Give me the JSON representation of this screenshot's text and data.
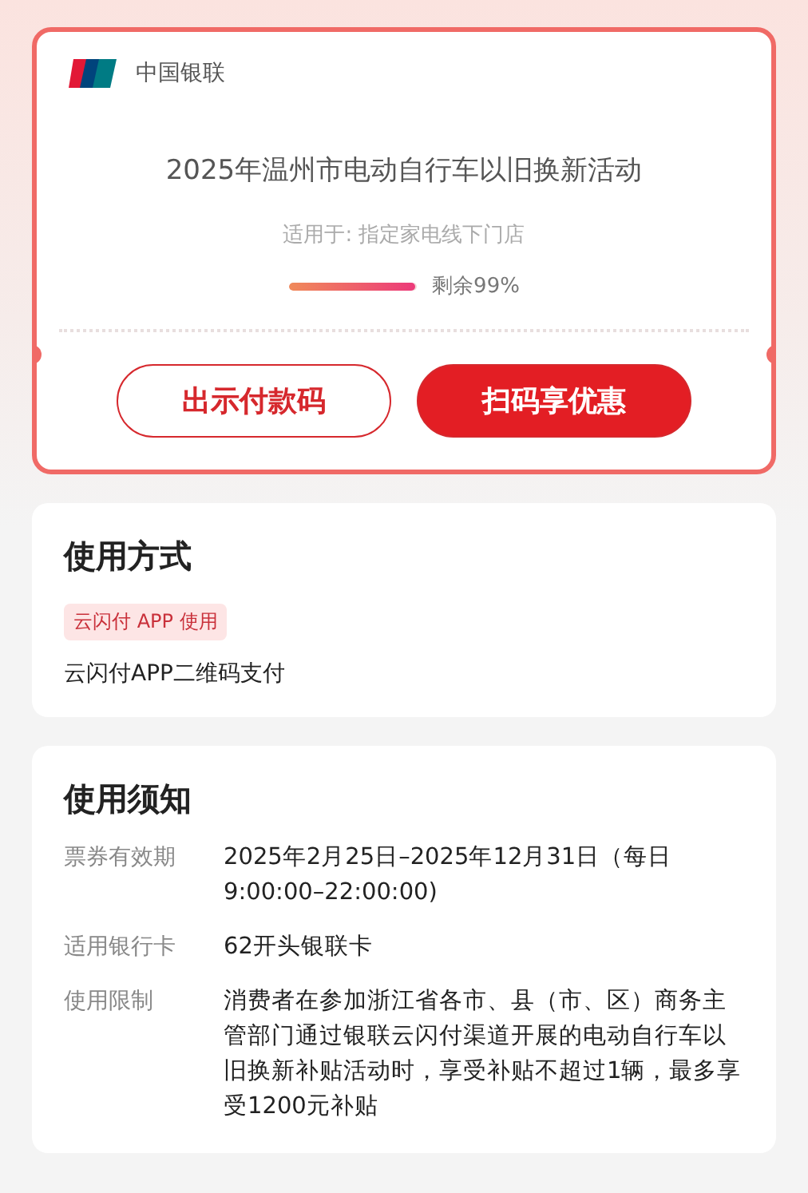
{
  "coupon": {
    "issuer": "中国银联",
    "title": "2025年温州市电动自行车以旧换新活动",
    "applies_to": "适用于: 指定家电线下门店",
    "remaining": {
      "level": 0.99,
      "label": "剩余99%"
    },
    "buttons": [
      {
        "label": "出示付款码",
        "kind": "outline"
      },
      {
        "label": "扫码享优惠",
        "kind": "filled"
      }
    ]
  },
  "usage": {
    "heading": "使用方式",
    "tag": "云闪付 APP 使用",
    "text": "云闪付APP二维码支付"
  },
  "notice": {
    "heading": "使用须知",
    "rows": [
      {
        "label": "票券有效期",
        "value": "2025年2月25日–2025年12月31日（每日 9:00:00–22:00:00)"
      },
      {
        "label": "适用银行卡",
        "value": "62开头银联卡"
      },
      {
        "label": "使用限制",
        "value": "消费者在参加浙江省各市、县（市、区）商务主管部门通过银联云闪付渠道开展的电动自行车以旧换新补贴活动时，享受补贴不超过1辆，最多享受1200元补贴"
      }
    ]
  }
}
